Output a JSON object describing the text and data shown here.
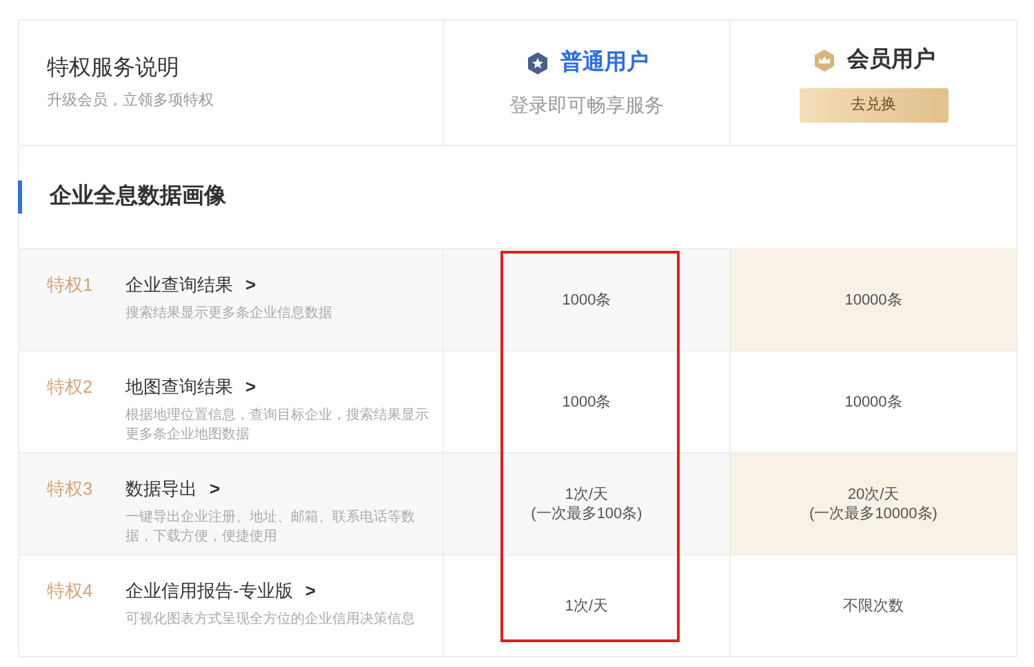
{
  "header": {
    "title": "特权服务说明",
    "subtitle": "升级会员，立领多项特权"
  },
  "plans": [
    {
      "kind": "basic",
      "name": "普通用户",
      "note": "登录即可畅享服务"
    },
    {
      "kind": "member",
      "name": "会员用户",
      "button": "去兑换"
    }
  ],
  "section": {
    "title": "企业全息数据画像"
  },
  "rows": [
    {
      "tag": "特权1",
      "title": "企业查询结果",
      "chevron": ">",
      "desc": "搜索结果显示更多条企业信息数据",
      "shaded": true,
      "basic": "1000条",
      "member": "10000条"
    },
    {
      "tag": "特权2",
      "title": "地图查询结果",
      "chevron": ">",
      "desc": "根据地理位置信息，查询目标企业，搜索结果显示更多条企业地图数据",
      "shaded": false,
      "basic": "1000条",
      "member": "10000条"
    },
    {
      "tag": "特权3",
      "title": "数据导出",
      "chevron": ">",
      "desc": "一键导出企业注册、地址、邮箱、联系电话等数据，下载方便，便捷使用",
      "shaded": true,
      "basic": "1次/天\n(一次最多100条)",
      "member": "20次/天\n(一次最多10000条)"
    },
    {
      "tag": "特权4",
      "title": "企业信用报告-专业版",
      "chevron": ">",
      "desc": "可视化图表方式呈现全方位的企业信用决策信息",
      "shaded": false,
      "basic": "1次/天",
      "member": "不限次数"
    }
  ],
  "highlight_frame": true
}
